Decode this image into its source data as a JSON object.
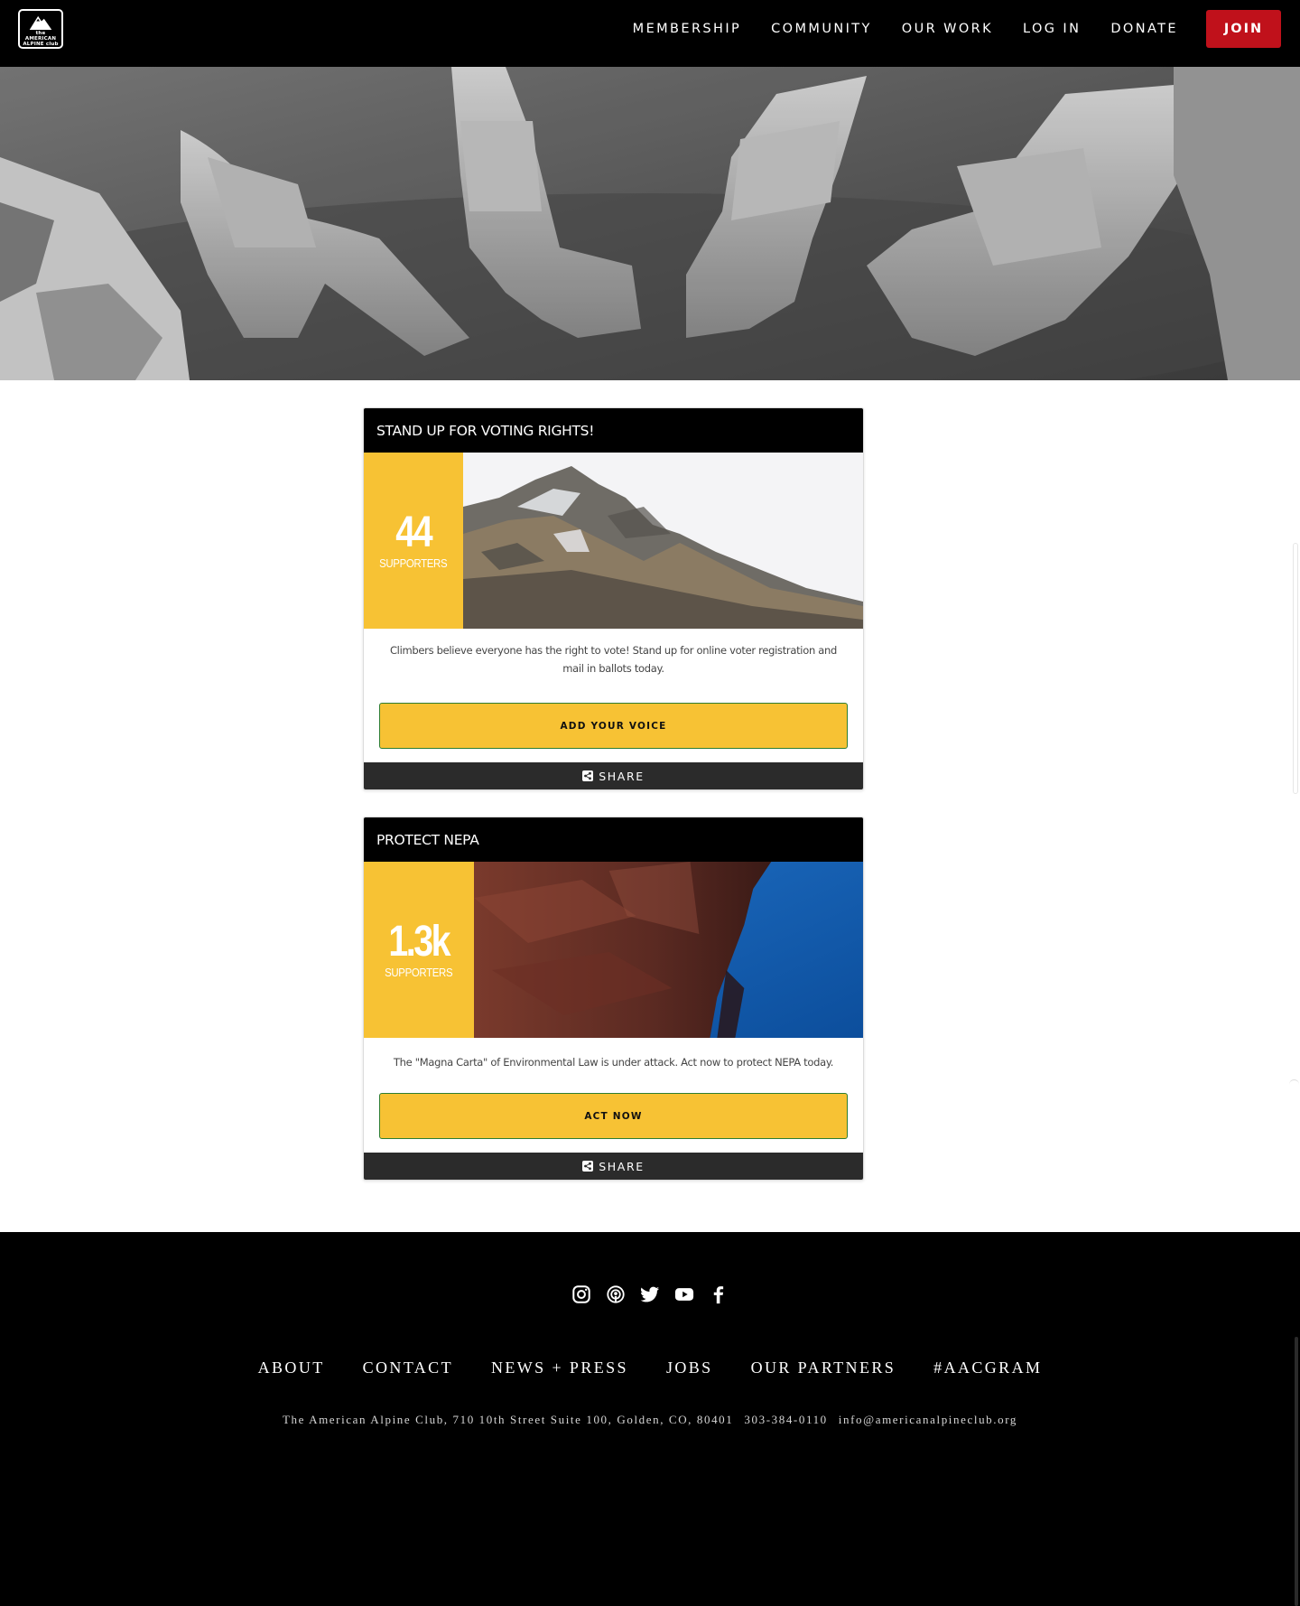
{
  "nav": {
    "logo_text": [
      "the",
      "AMERICAN",
      "ALPINE club"
    ],
    "links": [
      {
        "label": "MEMBERSHIP"
      },
      {
        "label": "COMMUNITY"
      },
      {
        "label": "OUR WORK"
      },
      {
        "label": "LOG IN"
      },
      {
        "label": "DONATE"
      }
    ],
    "join_label": "JOIN",
    "join_color": "#c0111b"
  },
  "campaigns": [
    {
      "title": "STAND UP FOR VOTING RIGHTS!",
      "count": "44",
      "count_label": "SUPPORTERS",
      "description": "Climbers believe everyone has the right to vote! Stand up for online voter registration and mail in ballots today.",
      "cta_label": "ADD YOUR VOICE",
      "share_label": "SHARE"
    },
    {
      "title": "PROTECT NEPA",
      "count": "1.3k",
      "count_label": "SUPPORTERS",
      "description": "The \"Magna Carta\" of Environmental Law is under attack. Act now to protect NEPA today.",
      "cta_label": "ACT NOW",
      "share_label": "SHARE"
    }
  ],
  "colors": {
    "accent_yellow": "#f7c234",
    "cta_border": "#2e7d32",
    "header_black": "#000000",
    "share_bar": "#2b2b2b"
  },
  "footer": {
    "socials": [
      {
        "icon": "instagram-icon"
      },
      {
        "icon": "podcast-icon"
      },
      {
        "icon": "twitter-icon"
      },
      {
        "icon": "youtube-icon"
      },
      {
        "icon": "facebook-icon"
      }
    ],
    "links": [
      {
        "label": "ABOUT"
      },
      {
        "label": "CONTACT"
      },
      {
        "label": "NEWS + PRESS"
      },
      {
        "label": "JOBS"
      },
      {
        "label": "OUR PARTNERS"
      },
      {
        "label": "#AACGRAM"
      }
    ],
    "address": "The American Alpine Club, 710 10th Street Suite 100, Golden, CO, 80401",
    "phone": "303-384-0110",
    "email": "info@americanalpineclub.org"
  }
}
